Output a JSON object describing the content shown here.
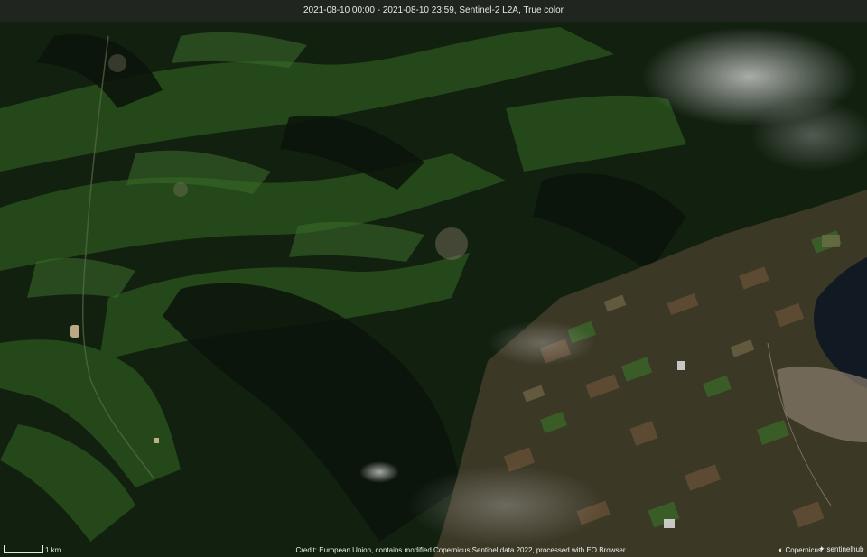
{
  "header": {
    "caption": "2021-08-10 00:00 - 2021-08-10 23:59, Sentinel-2 L2A, True color"
  },
  "scale": {
    "label": "1 km"
  },
  "footer": {
    "credit": "Credit: European Union, contains modified Copernicus Sentinel data 2022, processed with EO Browser",
    "logo_copernicus": "Copernicus",
    "logo_sentinelhub": "sentinelhub"
  },
  "map": {
    "type": "satellite-true-color",
    "colors": {
      "forest": "#0f1a0c",
      "meadow": "#2d5a22",
      "farmland": "#5a4a35",
      "lake": "#111922",
      "cloud": "#dcdcdc",
      "town": "#8a7d6d"
    }
  }
}
